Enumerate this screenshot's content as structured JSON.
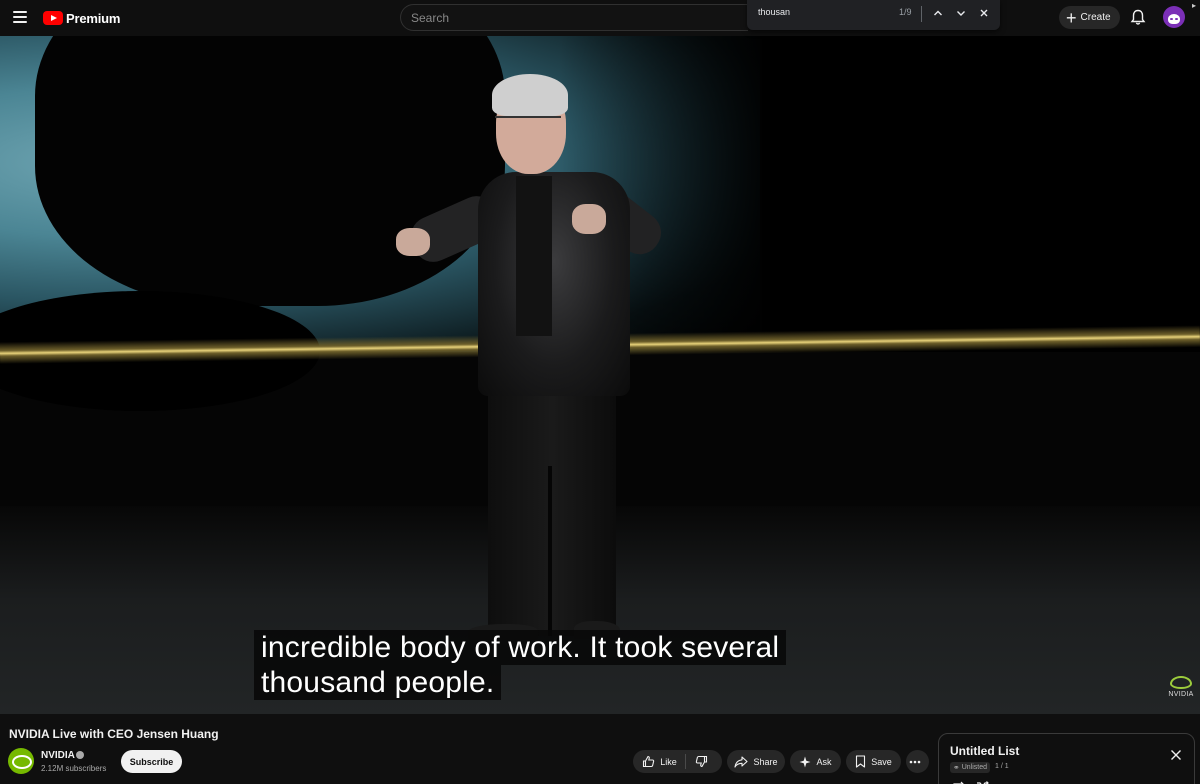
{
  "topbar": {
    "logo_text": "Premium",
    "search_placeholder": "Search",
    "find": {
      "query": "thousan",
      "count": "1/9"
    },
    "create_label": "Create"
  },
  "video": {
    "caption_lines": [
      "incredible body of work. It took several",
      "thousand people."
    ],
    "watermark_text": "NVIDIA"
  },
  "details": {
    "title": "NVIDIA Live with CEO Jensen Huang",
    "channel_name": "NVIDIA",
    "subscribers": "2.12M subscribers",
    "subscribe_label": "Subscribe",
    "actions": {
      "like": "Like",
      "share": "Share",
      "ask": "Ask",
      "save": "Save"
    }
  },
  "playlist": {
    "title": "Untitled List",
    "visibility": "Unlisted",
    "position": "1 / 1"
  },
  "icons": {
    "menu": "hamburger-icon",
    "find_prev": "chevron-up-icon",
    "find_next": "chevron-down-icon",
    "find_close": "close-icon",
    "notifications": "bell-icon",
    "like": "thumbs-up-icon",
    "dislike": "thumbs-down-icon",
    "share": "share-arrow-icon",
    "ask": "sparkle-icon",
    "save": "bookmark-icon",
    "more": "more-horizontal-icon",
    "loop": "loop-icon",
    "shuffle": "shuffle-icon"
  },
  "colors": {
    "background": "#0f0f0f",
    "brand_red": "#ff0000",
    "nvidia_green": "#76b900",
    "pill": "#272727"
  }
}
